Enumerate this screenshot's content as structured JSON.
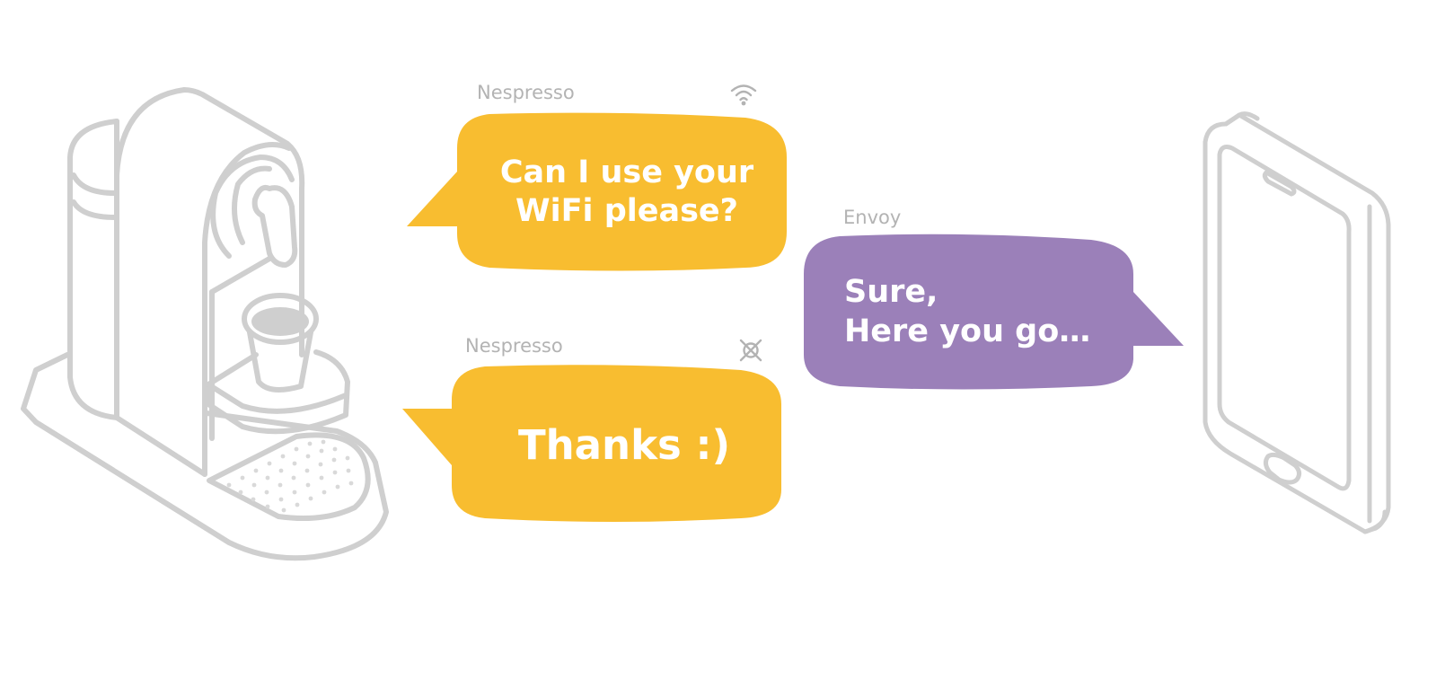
{
  "colors": {
    "device_bubble": "#f8bd30",
    "envoy_bubble": "#9b80b9",
    "outline": "#cfcfcf",
    "sender_label": "#b3b3b3",
    "bubble_text": "#ffffff"
  },
  "icons": {
    "request_status": "wifi-icon",
    "thanks_status": "wifi-disconnected-icon",
    "left_device": "coffee-machine-icon",
    "right_device": "smartphone-icon"
  },
  "messages": [
    {
      "sender": "Nespresso",
      "text": "Can I use your\nWiFi please?"
    },
    {
      "sender": "Envoy",
      "text": "Sure,\nHere you go…"
    },
    {
      "sender": "Nespresso",
      "text": "Thanks :)"
    }
  ]
}
